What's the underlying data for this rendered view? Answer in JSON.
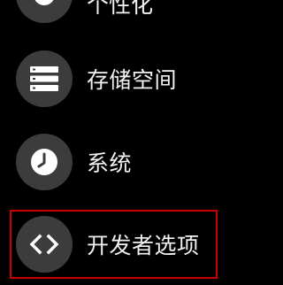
{
  "settings_list": {
    "items": [
      {
        "label": "个性化",
        "icon": "palette-icon",
        "partial": true
      },
      {
        "label": "存储空间",
        "icon": "storage-icon"
      },
      {
        "label": "系统",
        "icon": "clock-icon"
      },
      {
        "label": "开发者选项",
        "icon": "code-brackets-icon",
        "selected": true
      }
    ]
  },
  "colors": {
    "background": "#000000",
    "icon_circle": "#3c3c3c",
    "text": "#f2f2f2",
    "selection_border": "#cc0000"
  }
}
